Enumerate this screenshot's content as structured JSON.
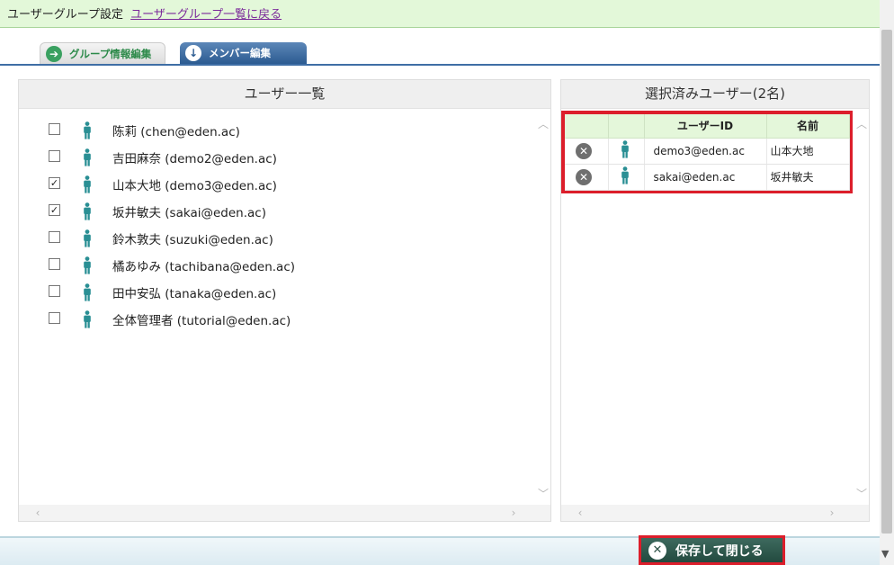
{
  "header": {
    "title": "ユーザーグループ設定",
    "back_link": "ユーザーグループ一覧に戻る"
  },
  "tabs": [
    {
      "label": "グループ情報編集",
      "icon": "arrow-right-icon",
      "active": false
    },
    {
      "label": "メンバー編集",
      "icon": "arrow-down-icon",
      "active": true
    }
  ],
  "user_list": {
    "title": "ユーザー一覧",
    "users": [
      {
        "label": "陈莉 (chen@eden.ac)",
        "checked": false
      },
      {
        "label": "吉田麻奈 (demo2@eden.ac)",
        "checked": false
      },
      {
        "label": "山本大地 (demo3@eden.ac)",
        "checked": true
      },
      {
        "label": "坂井敏夫 (sakai@eden.ac)",
        "checked": true
      },
      {
        "label": "鈴木敦夫 (suzuki@eden.ac)",
        "checked": false
      },
      {
        "label": "橘あゆみ (tachibana@eden.ac)",
        "checked": false
      },
      {
        "label": "田中安弘 (tanaka@eden.ac)",
        "checked": false
      },
      {
        "label": "全体管理者 (tutorial@eden.ac)",
        "checked": false
      }
    ]
  },
  "selected": {
    "title": "選択済みユーザー(2名)",
    "columns": [
      "",
      "",
      "ユーザーID",
      "名前"
    ],
    "rows": [
      {
        "user_id": "demo3@eden.ac",
        "name": "山本大地"
      },
      {
        "user_id": "sakai@eden.ac",
        "name": "坂井敏夫"
      }
    ]
  },
  "footer": {
    "save_label": "保存して閉じる"
  },
  "colors": {
    "header_bg": "#e3f8d9",
    "active_tab": "#2c5b91",
    "highlight": "#dc1e2b",
    "person_icon": "#2a8f94",
    "save_button": "#2d5247"
  }
}
